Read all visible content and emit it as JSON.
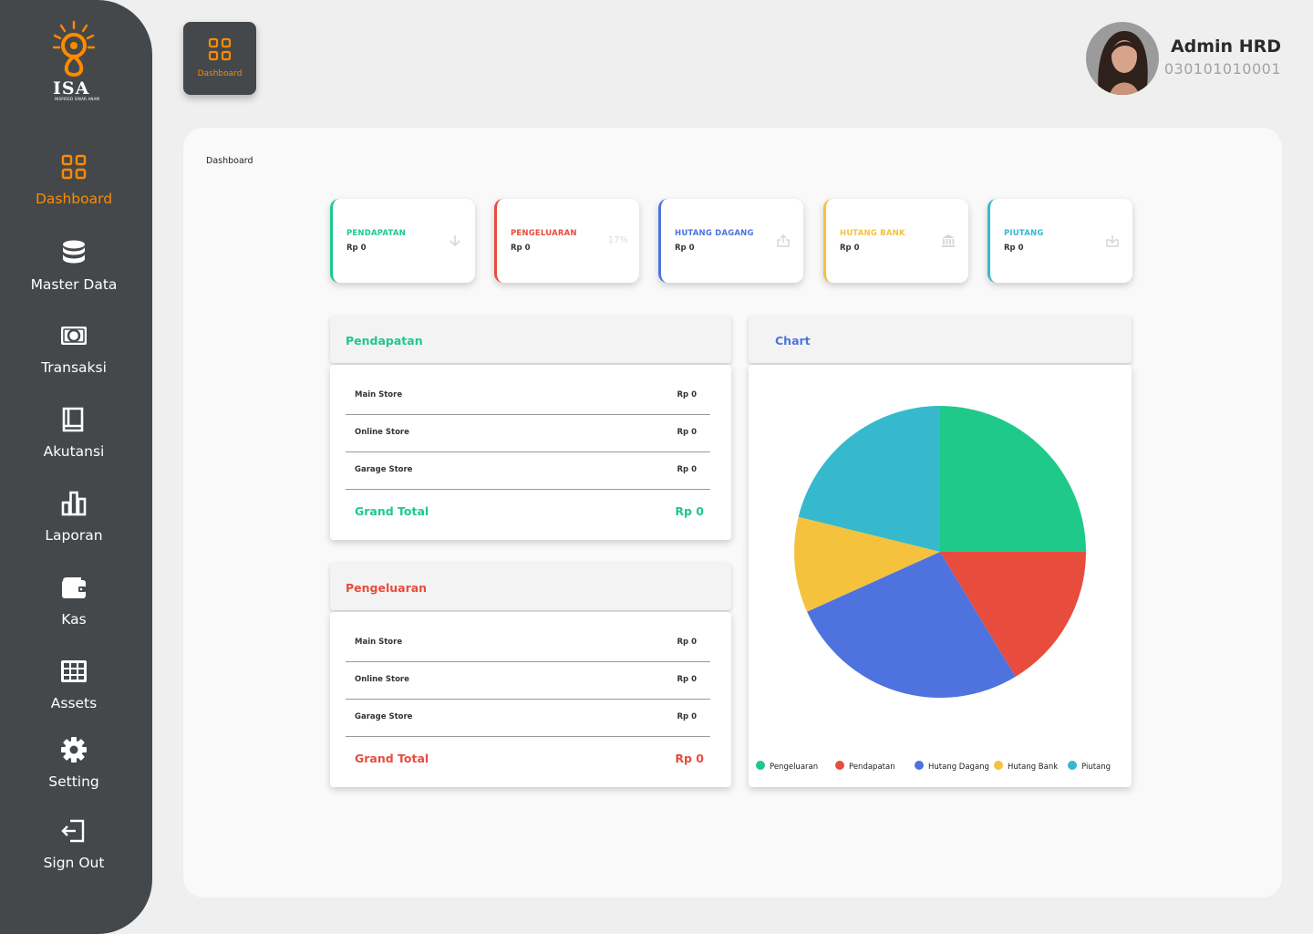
{
  "logo": {
    "text": "ISA",
    "subtitle": "INSPIRED SINAR ANAM"
  },
  "sidebar": {
    "items": [
      {
        "label": "Dashboard",
        "icon": "grid-icon",
        "active": true
      },
      {
        "label": "Master Data",
        "icon": "database-icon"
      },
      {
        "label": "Transaksi",
        "icon": "money-icon"
      },
      {
        "label": "Akutansi",
        "icon": "book-icon"
      },
      {
        "label": "Laporan",
        "icon": "bar-chart-icon"
      },
      {
        "label": "Kas",
        "icon": "wallet-icon"
      },
      {
        "label": "Assets",
        "icon": "table-icon"
      },
      {
        "label": "Setting",
        "icon": "gear-icon"
      },
      {
        "label": "Sign Out",
        "icon": "sign-out-icon"
      }
    ]
  },
  "header": {
    "dashboard_button": "Dashboard",
    "user": {
      "name": "Admin HRD",
      "id": "030101010001"
    }
  },
  "main": {
    "breadcrumb": "Dashboard",
    "stats": [
      {
        "title": "PENDAPATAN",
        "value": "Rp 0",
        "color": "#1ec98a",
        "icon": "arrow-down-icon"
      },
      {
        "title": "PENGELUARAN",
        "value": "Rp 0",
        "color": "#e84c3d",
        "badge": "17%"
      },
      {
        "title": "HUTANG DAGANG",
        "value": "Rp 0",
        "color": "#4e73df",
        "icon": "share-icon"
      },
      {
        "title": "HUTANG BANK",
        "value": "Rp 0",
        "color": "#f4c23d",
        "icon": "bank-icon"
      },
      {
        "title": "PIUTANG",
        "value": "Rp 0",
        "color": "#36b9cc",
        "icon": "download-icon"
      }
    ],
    "pendapatan": {
      "title": "Pendapatan",
      "color": "#1ec98a",
      "rows": [
        {
          "label": "Main Store",
          "value": "Rp 0"
        },
        {
          "label": "Online Store",
          "value": "Rp 0"
        },
        {
          "label": "Garage Store",
          "value": "Rp 0"
        }
      ],
      "total_label": "Grand Total",
      "total_value": "Rp 0"
    },
    "pengeluaran": {
      "title": "Pengeluaran",
      "color": "#e84c3d",
      "rows": [
        {
          "label": "Main Store",
          "value": "Rp 0"
        },
        {
          "label": "Online Store",
          "value": "Rp 0"
        },
        {
          "label": "Garage Store",
          "value": "Rp 0"
        }
      ],
      "total_label": "Grand Total",
      "total_value": "Rp 0"
    },
    "chart_title": "Chart"
  },
  "colors": {
    "accent": "#ff8a00",
    "sidebar": "#44484b",
    "chart_title": "#4e73df"
  },
  "chart_data": {
    "type": "pie",
    "title": "",
    "slices": [
      {
        "name": "Pengeluaran",
        "value": 26,
        "color": "#1ec98a"
      },
      {
        "name": "Pendapatan",
        "value": 17,
        "color": "#e84c3d"
      },
      {
        "name": "Hutang Dagang",
        "value": 28,
        "color": "#4e73df"
      },
      {
        "name": "Hutang Bank",
        "value": 11,
        "color": "#f4c23d"
      },
      {
        "name": "Piutang",
        "value": 22,
        "color": "#36b9cc"
      }
    ],
    "legend_position": "bottom"
  }
}
